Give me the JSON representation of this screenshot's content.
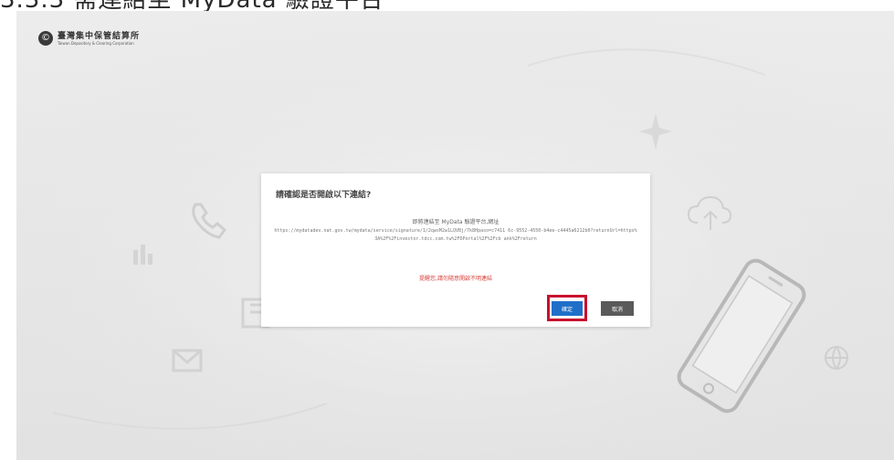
{
  "doc": {
    "heading": "3.3.3 需連結至 MyData 驗證平台"
  },
  "logo": {
    "mark": "©",
    "name": "臺灣集中保管結算所",
    "subtitle": "Taiwan Depository & Clearing Corporation"
  },
  "dialog": {
    "title": "請確認是否開啟以下連結?",
    "intro": "即將連結至 MyData 驗證平台,網址",
    "url": "https://mydatadev.nat.gov.tw/mydata/service/signature/1/2qwsM2w1LQVBj/7k8Hpaso=c7411 6c-9552-4550-b4ee-c4445a6212b0?returnUrl=https%3A%2F%2Finvestor.tdcc.com.tw%2FDPortal%2F%2Fcb ank%2Freturn",
    "warning": "提醒您,請勿隨意開啟不明連結",
    "confirm_label": "確定",
    "cancel_label": "取消"
  },
  "colors": {
    "confirm": "#1f6fc9",
    "cancel": "#5a5a5a",
    "highlight": "#c8102e",
    "warning": "#d9423a"
  }
}
